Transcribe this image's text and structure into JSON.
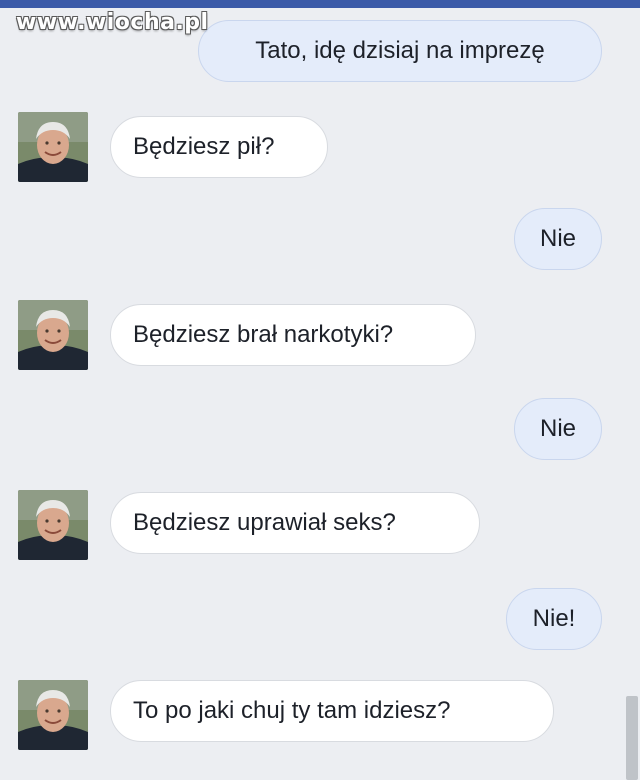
{
  "watermark": "www.wiocha.pl",
  "messages": [
    {
      "side": "out",
      "text": "Tato, idę dzisiaj na imprezę"
    },
    {
      "side": "in",
      "text": "Będziesz pił?"
    },
    {
      "side": "out",
      "text": "Nie"
    },
    {
      "side": "in",
      "text": "Będziesz brał narkotyki?"
    },
    {
      "side": "out",
      "text": "Nie"
    },
    {
      "side": "in",
      "text": "Będziesz uprawiał seks?"
    },
    {
      "side": "out",
      "text": "Nie!"
    },
    {
      "side": "in",
      "text": "To po jaki chuj ty tam idziesz?"
    }
  ],
  "colors": {
    "outgoing_bubble": "#e4ecfa",
    "incoming_bubble": "#ffffff",
    "background": "#eceef2",
    "top_bar": "#3b5aa8"
  },
  "icons": {
    "avatar": "person-photo-avatar"
  }
}
